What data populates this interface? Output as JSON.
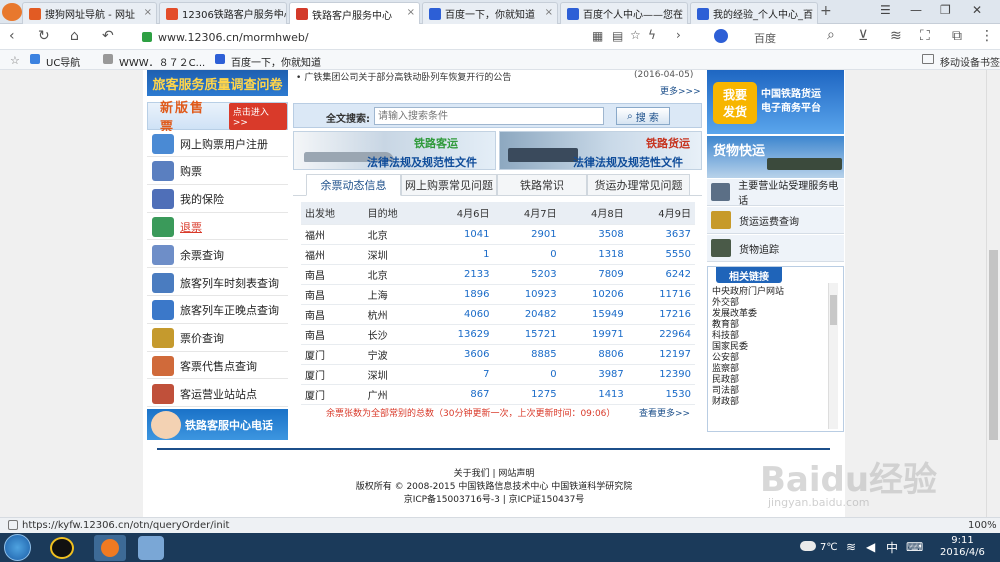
{
  "browser": {
    "tabs": [
      {
        "label": "搜狗网址导航 - 网址",
        "active": false,
        "favicon_color": "#e25b23"
      },
      {
        "label": "12306铁路客户服务中心",
        "active": false,
        "favicon_color": "#e34d2a"
      },
      {
        "label": "铁路客户服务中心",
        "active": true,
        "favicon_color": "#d33a2a"
      },
      {
        "label": "百度一下，你就知道",
        "active": false,
        "favicon_color": "#2d5fd6"
      },
      {
        "label": "百度个人中心——您在",
        "active": false,
        "favicon_color": "#2d5fd6"
      },
      {
        "label": "我的经验_个人中心_百",
        "active": false,
        "favicon_color": "#2d5fd6"
      }
    ],
    "new_tab": "+",
    "url": "www.12306.cn/mormhweb/",
    "search_engine": "百度",
    "bookmarks": [
      "UC导航",
      "WWW．８７２C...",
      "百度一下，你就知道"
    ],
    "bookmark_right": "移动设备书签",
    "status_url": "https://kyfw.12306.cn/otn/queryOrder/init",
    "zoom": "100%"
  },
  "page": {
    "notice_text": "广铁集团公司关于部分高铁动卧列车恢复开行的公告",
    "notice_date": "(2016-04-05)",
    "more": "更多>>>",
    "survey_banner": "旅客服务质量调查问卷",
    "new_ticketing": "新版售票",
    "click_enter": "点击进入>>",
    "left_menu": [
      {
        "label": "网上购票用户注册",
        "icon": "user-register-icon",
        "color": "#4a8ad4",
        "highlight": false
      },
      {
        "label": "购票",
        "icon": "ticket-icon",
        "color": "#5a7fc0",
        "highlight": false
      },
      {
        "label": "我的保险",
        "icon": "insurance-icon",
        "color": "#4f6fb8",
        "highlight": false
      },
      {
        "label": "退票",
        "icon": "refund-icon",
        "color": "#3a9a5a",
        "highlight": true
      },
      {
        "label": "余票查询",
        "icon": "search-ticket-icon",
        "color": "#6e8ec8",
        "highlight": false
      },
      {
        "label": "旅客列车时刻表查询",
        "icon": "timetable-icon",
        "color": "#4a7cc0",
        "highlight": false
      },
      {
        "label": "旅客列车正晚点查询",
        "icon": "clock-icon",
        "color": "#3b78c9",
        "highlight": false
      },
      {
        "label": "票价查询",
        "icon": "price-icon",
        "color": "#c59a2d",
        "highlight": false
      },
      {
        "label": "客票代售点查询",
        "icon": "shop-icon",
        "color": "#d06a3a",
        "highlight": false
      },
      {
        "label": "客运营业站站点",
        "icon": "station-icon",
        "color": "#c0503a",
        "highlight": false
      }
    ],
    "service_banner": "铁路客服中心电话",
    "search_label": "全文搜索:",
    "search_placeholder": "请输入搜索条件",
    "search_button": "搜 索",
    "banner_passenger": {
      "title": "铁路客运",
      "subtitle": "法律法规及规范性文件"
    },
    "banner_freight": {
      "title": "铁路货运",
      "subtitle": "法律法规及规范性文件"
    },
    "content_tabs": [
      "余票动态信息",
      "网上购票常见问题",
      "铁路常识",
      "货运办理常见问题"
    ],
    "table": {
      "headers": [
        "出发地",
        "目的地",
        "4月6日",
        "4月7日",
        "4月8日",
        "4月9日"
      ],
      "rows": [
        [
          "福州",
          "北京",
          "1041",
          "2901",
          "3508",
          "3637"
        ],
        [
          "福州",
          "深圳",
          "1",
          "0",
          "1318",
          "5550"
        ],
        [
          "南昌",
          "北京",
          "2133",
          "5203",
          "7809",
          "6242"
        ],
        [
          "南昌",
          "上海",
          "1896",
          "10923",
          "10206",
          "11716"
        ],
        [
          "南昌",
          "杭州",
          "4060",
          "20482",
          "15949",
          "17216"
        ],
        [
          "南昌",
          "长沙",
          "13629",
          "15721",
          "19971",
          "22964"
        ],
        [
          "厦门",
          "宁波",
          "3606",
          "8885",
          "8806",
          "12197"
        ],
        [
          "厦门",
          "深圳",
          "7",
          "0",
          "3987",
          "12390"
        ],
        [
          "厦门",
          "广州",
          "867",
          "1275",
          "1413",
          "1530"
        ]
      ],
      "note": "余票张数为全部常别的总数（30分钟更新一次，上次更新时间：09:06）",
      "more": "查看更多>>"
    },
    "right_banner_freight": {
      "line1": "我要",
      "line2": "发货",
      "title1": "中国铁路货运",
      "title2": "电子商务平台"
    },
    "right_banner_express": "货物快运",
    "right_links": [
      {
        "label": "主要营业站受理服务电话",
        "icon": "phone-icon"
      },
      {
        "label": "货运运费查询",
        "icon": "calculator-icon"
      },
      {
        "label": "货物追踪",
        "icon": "train-icon"
      }
    ],
    "related_links_title": "相关链接",
    "related_links": [
      "中央政府门户网站",
      "外交部",
      "发展改革委",
      "教育部",
      "科技部",
      "国家民委",
      "公安部",
      "监察部",
      "民政部",
      "司法部",
      "财政部"
    ],
    "footer": {
      "links": "关于我们 | 网站声明",
      "copyright": "版权所有 © 2008-2015 中国铁路信息技术中心 中国铁道科学研究院",
      "icp": "京ICP备15003716号-3 | 京ICP证150437号"
    }
  },
  "watermark": {
    "text": "Baidu经验",
    "url": "jingyan.baidu.com"
  },
  "taskbar": {
    "time": "9:11",
    "date": "2016/4/6",
    "temp": "7℃",
    "lang": "中"
  }
}
